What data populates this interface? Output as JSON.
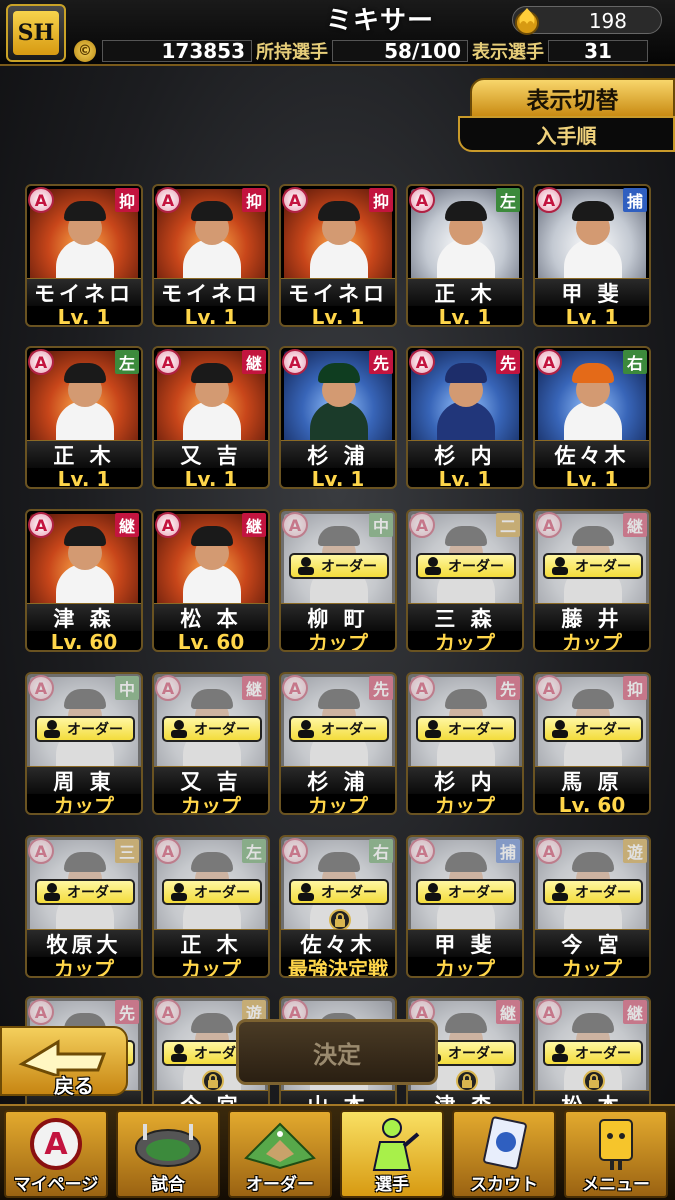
{
  "header": {
    "title": "ミキサー",
    "logo_text": "SH",
    "tickets": "198",
    "coins": "173853",
    "owned_label": "所持選手",
    "owned_value": "58/100",
    "shown_label": "表示選手",
    "shown_value": "31"
  },
  "display_switch": {
    "label": "表示切替",
    "sort": "入手順"
  },
  "colors": {
    "pos_closer": "#c3143f",
    "pos_relief": "#c3143f",
    "pos_starter": "#c3143f",
    "pos_left": "#3c8a3c",
    "pos_center": "#3c8a3c",
    "pos_right": "#3c8a3c",
    "pos_catcher": "#2f5fc0",
    "pos_first": "#c28a10",
    "pos_second": "#c28a10",
    "pos_third": "#c28a10",
    "pos_short": "#c28a10"
  },
  "cards": [
    {
      "rank": "A",
      "pos": "抑",
      "name": "モイネロ",
      "level": "Lv.  1",
      "state": "normal",
      "art": "fire"
    },
    {
      "rank": "A",
      "pos": "抑",
      "name": "モイネロ",
      "level": "Lv.  1",
      "state": "normal",
      "art": "fire"
    },
    {
      "rank": "A",
      "pos": "抑",
      "name": "モイネロ",
      "level": "Lv.  1",
      "state": "normal",
      "art": "fire"
    },
    {
      "rank": "A",
      "pos": "左",
      "name": "正 木",
      "level": "Lv.  1",
      "state": "normal",
      "art": "white"
    },
    {
      "rank": "A",
      "pos": "捕",
      "name": "甲 斐",
      "level": "Lv.  1",
      "state": "normal",
      "art": "white"
    },
    {
      "rank": "A",
      "pos": "左",
      "name": "正 木",
      "level": "Lv.  1",
      "state": "normal",
      "art": "fire"
    },
    {
      "rank": "A",
      "pos": "継",
      "name": "又 吉",
      "level": "Lv.  1",
      "state": "normal",
      "art": "fire"
    },
    {
      "rank": "A",
      "pos": "先",
      "name": "杉 浦",
      "level": "Lv.  1",
      "state": "normal",
      "art": "blue"
    },
    {
      "rank": "A",
      "pos": "先",
      "name": "杉 内",
      "level": "Lv.  1",
      "state": "normal",
      "art": "blue"
    },
    {
      "rank": "A",
      "pos": "右",
      "name": "佐々木",
      "level": "Lv.  1",
      "state": "normal",
      "art": "blue"
    },
    {
      "rank": "A",
      "pos": "継",
      "name": "津 森",
      "level": "Lv. 60",
      "state": "normal",
      "art": "fire"
    },
    {
      "rank": "A",
      "pos": "継",
      "name": "松 本",
      "level": "Lv. 60",
      "state": "normal",
      "art": "fire"
    },
    {
      "rank": "A",
      "pos": "中",
      "name": "柳 町",
      "level": "カップ",
      "state": "order",
      "art": "white"
    },
    {
      "rank": "A",
      "pos": "二",
      "name": "三 森",
      "level": "カップ",
      "state": "order",
      "art": "white"
    },
    {
      "rank": "A",
      "pos": "継",
      "name": "藤 井",
      "level": "カップ",
      "state": "order",
      "art": "white"
    },
    {
      "rank": "A",
      "pos": "中",
      "name": "周 東",
      "level": "カップ",
      "state": "order",
      "art": "white"
    },
    {
      "rank": "A",
      "pos": "継",
      "name": "又 吉",
      "level": "カップ",
      "state": "order",
      "art": "white"
    },
    {
      "rank": "A",
      "pos": "先",
      "name": "杉 浦",
      "level": "カップ",
      "state": "order",
      "art": "white"
    },
    {
      "rank": "A",
      "pos": "先",
      "name": "杉 内",
      "level": "カップ",
      "state": "order",
      "art": "white"
    },
    {
      "rank": "A",
      "pos": "抑",
      "name": "馬 原",
      "level": "Lv. 60",
      "state": "order",
      "art": "white"
    },
    {
      "rank": "A",
      "pos": "三",
      "name": "牧原大",
      "level": "カップ",
      "state": "order",
      "art": "white"
    },
    {
      "rank": "A",
      "pos": "左",
      "name": "正 木",
      "level": "カップ",
      "state": "order",
      "art": "white"
    },
    {
      "rank": "A",
      "pos": "右",
      "name": "佐々木",
      "level": "最強決定戦",
      "state": "order-lock",
      "art": "white"
    },
    {
      "rank": "A",
      "pos": "捕",
      "name": "甲 斐",
      "level": "カップ",
      "state": "order",
      "art": "white"
    },
    {
      "rank": "A",
      "pos": "遊",
      "name": "今 宮",
      "level": "カップ",
      "state": "order",
      "art": "white"
    },
    {
      "rank": "A",
      "pos": "先",
      "name": "",
      "level": "",
      "state": "order",
      "art": "white"
    },
    {
      "rank": "A",
      "pos": "遊",
      "name": "今 宮",
      "level": "",
      "state": "order-lock",
      "art": "white"
    },
    {
      "rank": "A",
      "pos": "",
      "name": "山 本",
      "level": "",
      "state": "order",
      "art": "white"
    },
    {
      "rank": "A",
      "pos": "継",
      "name": "津 森",
      "level": "",
      "state": "order-lock",
      "art": "white"
    },
    {
      "rank": "A",
      "pos": "継",
      "name": "松 本",
      "level": "",
      "state": "order-lock",
      "art": "white"
    }
  ],
  "order_tag_label": "オーダー",
  "buttons": {
    "back": "戻る",
    "confirm": "決定"
  },
  "nav": [
    {
      "label": "マイページ",
      "icon": "a-emblem-icon"
    },
    {
      "label": "試合",
      "icon": "stadium-icon"
    },
    {
      "label": "オーダー",
      "icon": "field-icon"
    },
    {
      "label": "選手",
      "icon": "player-icon",
      "active": true
    },
    {
      "label": "スカウト",
      "icon": "scout-card-icon"
    },
    {
      "label": "メニュー",
      "icon": "menu-mascot-icon"
    }
  ]
}
